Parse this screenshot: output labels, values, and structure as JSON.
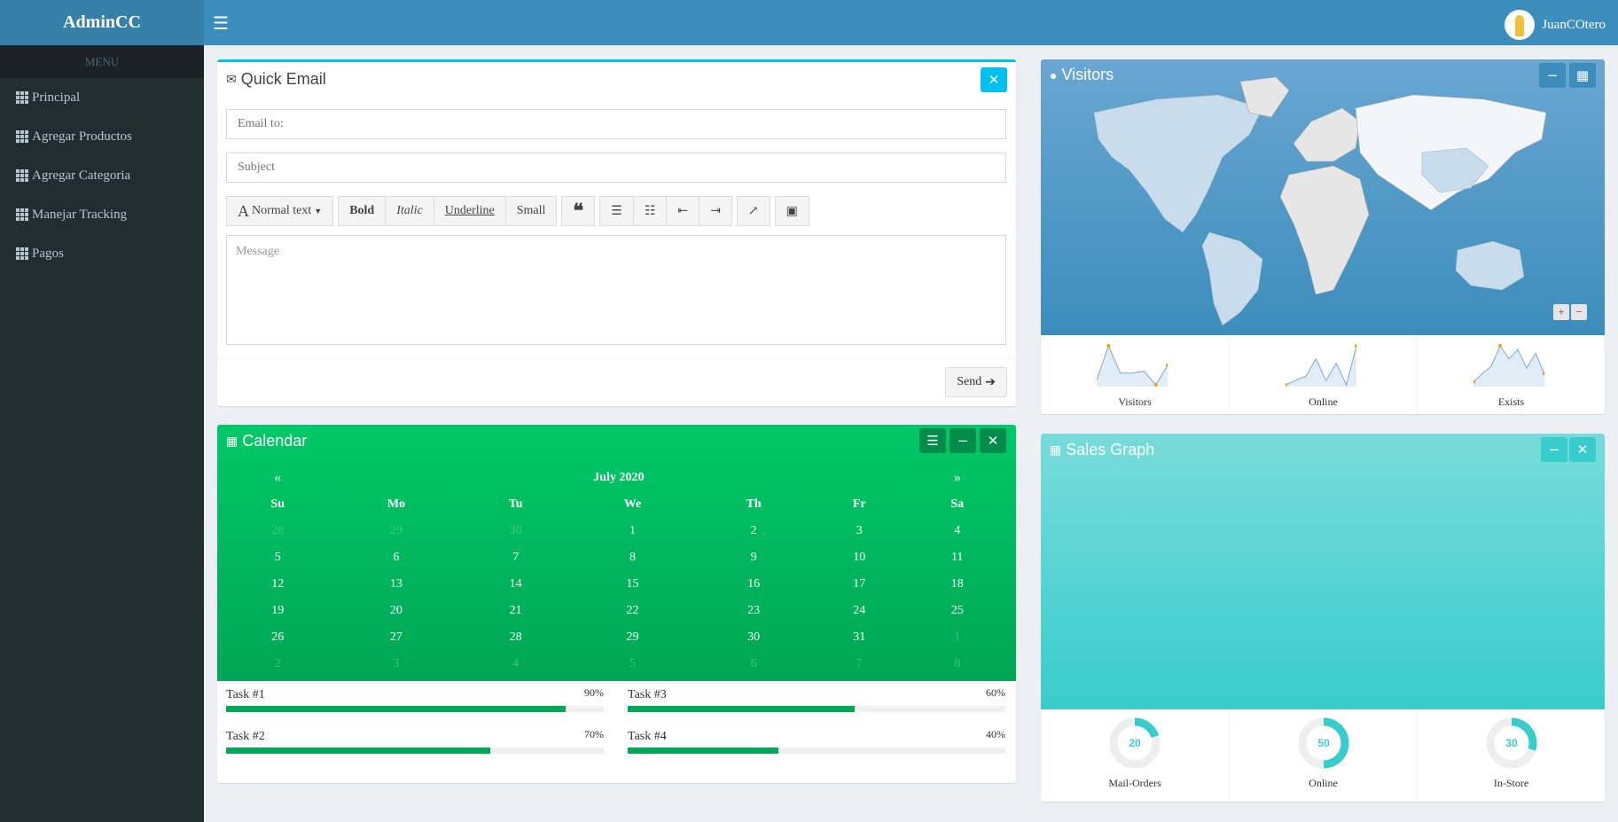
{
  "app": {
    "brand": "AdminCC",
    "user_name": "JuanCOtero"
  },
  "sidebar": {
    "header": "MENU",
    "items": [
      {
        "label": "Principal"
      },
      {
        "label": "Agregar Productos"
      },
      {
        "label": "Agregar Categoria"
      },
      {
        "label": "Manejar Tracking"
      },
      {
        "label": "Pagos"
      }
    ]
  },
  "quick_email": {
    "title": "Quick Email",
    "email_placeholder": "Email to:",
    "subject_placeholder": "Subject",
    "message_placeholder": "Message",
    "toolbar": {
      "normal_text": "Normal text",
      "bold": "Bold",
      "italic": "Italic",
      "underline": "Underline",
      "small": "Small"
    },
    "send_label": "Send"
  },
  "calendar": {
    "title": "Calendar",
    "month": "July 2020",
    "prev": "«",
    "next": "»",
    "weekdays": [
      "Su",
      "Mo",
      "Tu",
      "We",
      "Th",
      "Fr",
      "Sa"
    ],
    "weeks": [
      [
        [
          "28",
          true
        ],
        [
          "29",
          true
        ],
        [
          "30",
          true
        ],
        [
          "1",
          false
        ],
        [
          "2",
          false
        ],
        [
          "3",
          false
        ],
        [
          "4",
          false
        ]
      ],
      [
        [
          "5",
          false
        ],
        [
          "6",
          false
        ],
        [
          "7",
          false
        ],
        [
          "8",
          false
        ],
        [
          "9",
          false
        ],
        [
          "10",
          false
        ],
        [
          "11",
          false
        ]
      ],
      [
        [
          "12",
          false
        ],
        [
          "13",
          false
        ],
        [
          "14",
          false
        ],
        [
          "15",
          false
        ],
        [
          "16",
          false
        ],
        [
          "17",
          false
        ],
        [
          "18",
          false
        ]
      ],
      [
        [
          "19",
          false
        ],
        [
          "20",
          false
        ],
        [
          "21",
          false
        ],
        [
          "22",
          false
        ],
        [
          "23",
          false
        ],
        [
          "24",
          false
        ],
        [
          "25",
          false
        ]
      ],
      [
        [
          "26",
          false
        ],
        [
          "27",
          false
        ],
        [
          "28",
          false
        ],
        [
          "29",
          false
        ],
        [
          "30",
          false
        ],
        [
          "31",
          false
        ],
        [
          "1",
          true
        ]
      ],
      [
        [
          "2",
          true
        ],
        [
          "3",
          true
        ],
        [
          "4",
          true
        ],
        [
          "5",
          true
        ],
        [
          "6",
          true
        ],
        [
          "7",
          true
        ],
        [
          "8",
          true
        ]
      ]
    ],
    "tasks": [
      {
        "label": "Task #1",
        "percent": "90%",
        "value": 90
      },
      {
        "label": "Task #2",
        "percent": "70%",
        "value": 70
      },
      {
        "label": "Task #3",
        "percent": "60%",
        "value": 60
      },
      {
        "label": "Task #4",
        "percent": "40%",
        "value": 40
      }
    ]
  },
  "visitors": {
    "title": "Visitors",
    "sparks": [
      {
        "label": "Visitors",
        "values": [
          5,
          40,
          12,
          12,
          14,
          0,
          20
        ]
      },
      {
        "label": "Online",
        "values": [
          0,
          5,
          10,
          30,
          5,
          25,
          0,
          45
        ]
      },
      {
        "label": "Exists",
        "values": [
          3,
          12,
          20,
          42,
          28,
          38,
          18,
          34,
          12
        ]
      }
    ]
  },
  "sales": {
    "title": "Sales Graph",
    "knobs": [
      {
        "label": "Mail-Orders",
        "value": "20"
      },
      {
        "label": "Online",
        "value": "50"
      },
      {
        "label": "In-Store",
        "value": "30"
      }
    ]
  },
  "colors": {
    "header": "#3c8dbc",
    "sidebar": "#222d32",
    "calendar": "#00a65a",
    "sales": "#39cccc",
    "info": "#00c0ef"
  }
}
